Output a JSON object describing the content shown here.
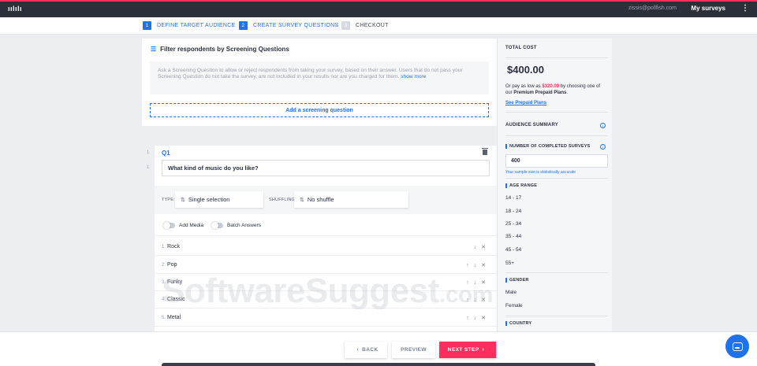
{
  "topbar": {
    "logo": "ıılılı",
    "email": "zissis@pollfish.com",
    "my_surveys": "My surveys",
    "menu_icon": "kebab-icon"
  },
  "stepper": {
    "steps": [
      {
        "num": "1",
        "label": "DEFINE TARGET AUDIENCE",
        "active": true
      },
      {
        "num": "2",
        "label": "CREATE SURVEY QUESTIONS",
        "active": true
      },
      {
        "num": "3",
        "label": "CHECKOUT",
        "active": false
      }
    ]
  },
  "filter": {
    "title": "Filter respondents by Screening Questions",
    "icon": "filter-icon",
    "description": "Ask a Screening Question to allow or reject respondents from taking your survey, based on their answer. Users that do not pass your Screening Question do not take the survey, are not included in your results nor are you charged for them.",
    "show_more": "show more",
    "add_button": "Add a screening question"
  },
  "question": {
    "gutter": [
      "1",
      "1"
    ],
    "label": "Q1",
    "text": "What kind of music do you like?",
    "type_label": "TYPE:",
    "type_value": "Single selection",
    "shuffling_label": "SHUFFLING:",
    "shuffling_value": "No shuffle",
    "toggles": {
      "media": "Add Media",
      "batch": "Batch Answers"
    },
    "answers": [
      {
        "num": "1.",
        "text": "Rock",
        "ctrl": "↓ ✕"
      },
      {
        "num": "2.",
        "text": "Pop",
        "ctrl": "↑ ↓ ✕"
      },
      {
        "num": "3.",
        "text": "Funky",
        "ctrl": "↑ ↓ ✕"
      },
      {
        "num": "4.",
        "text": "Classic",
        "ctrl": "↑ ↓ ✕"
      },
      {
        "num": "5.",
        "text": "Metal",
        "ctrl": "↑ ↓ ✕"
      }
    ]
  },
  "panel": {
    "total_cost_label": "TOTAL COST",
    "total_cost": "$400.00",
    "prepaid_pre": "Or pay as low as ",
    "prepaid_price": "$320.00",
    "prepaid_mid": " by choosing one of our ",
    "prepaid_plans": "Premium Prepaid Plans",
    "prepaid_end": ".",
    "see_plans": "See Prepaid Plans",
    "audience_summary": "AUDIENCE SUMMARY",
    "completed_label": "NUMBER OF COMPLETED SURVEYS",
    "completed_value": "400",
    "sample_note": "Your sample size is statistically accurate",
    "age_range_label": "AGE RANGE",
    "age_ranges": [
      "14 - 17",
      "18 - 24",
      "25 - 34",
      "35 - 44",
      "45 - 54",
      "55+"
    ],
    "gender_label": "GENDER",
    "genders": [
      "Male",
      "Female"
    ],
    "country_label": "COUNTRY"
  },
  "watermark": {
    "main": "SoftwareSuggest",
    "suffix": ".com"
  },
  "footer": {
    "back": "BACK",
    "preview": "PREVIEW",
    "next": "NEXT STEP"
  },
  "colors": {
    "accent": "#1f73e8",
    "brand": "#ff2e5e",
    "topbar": "#2b2f3a"
  }
}
